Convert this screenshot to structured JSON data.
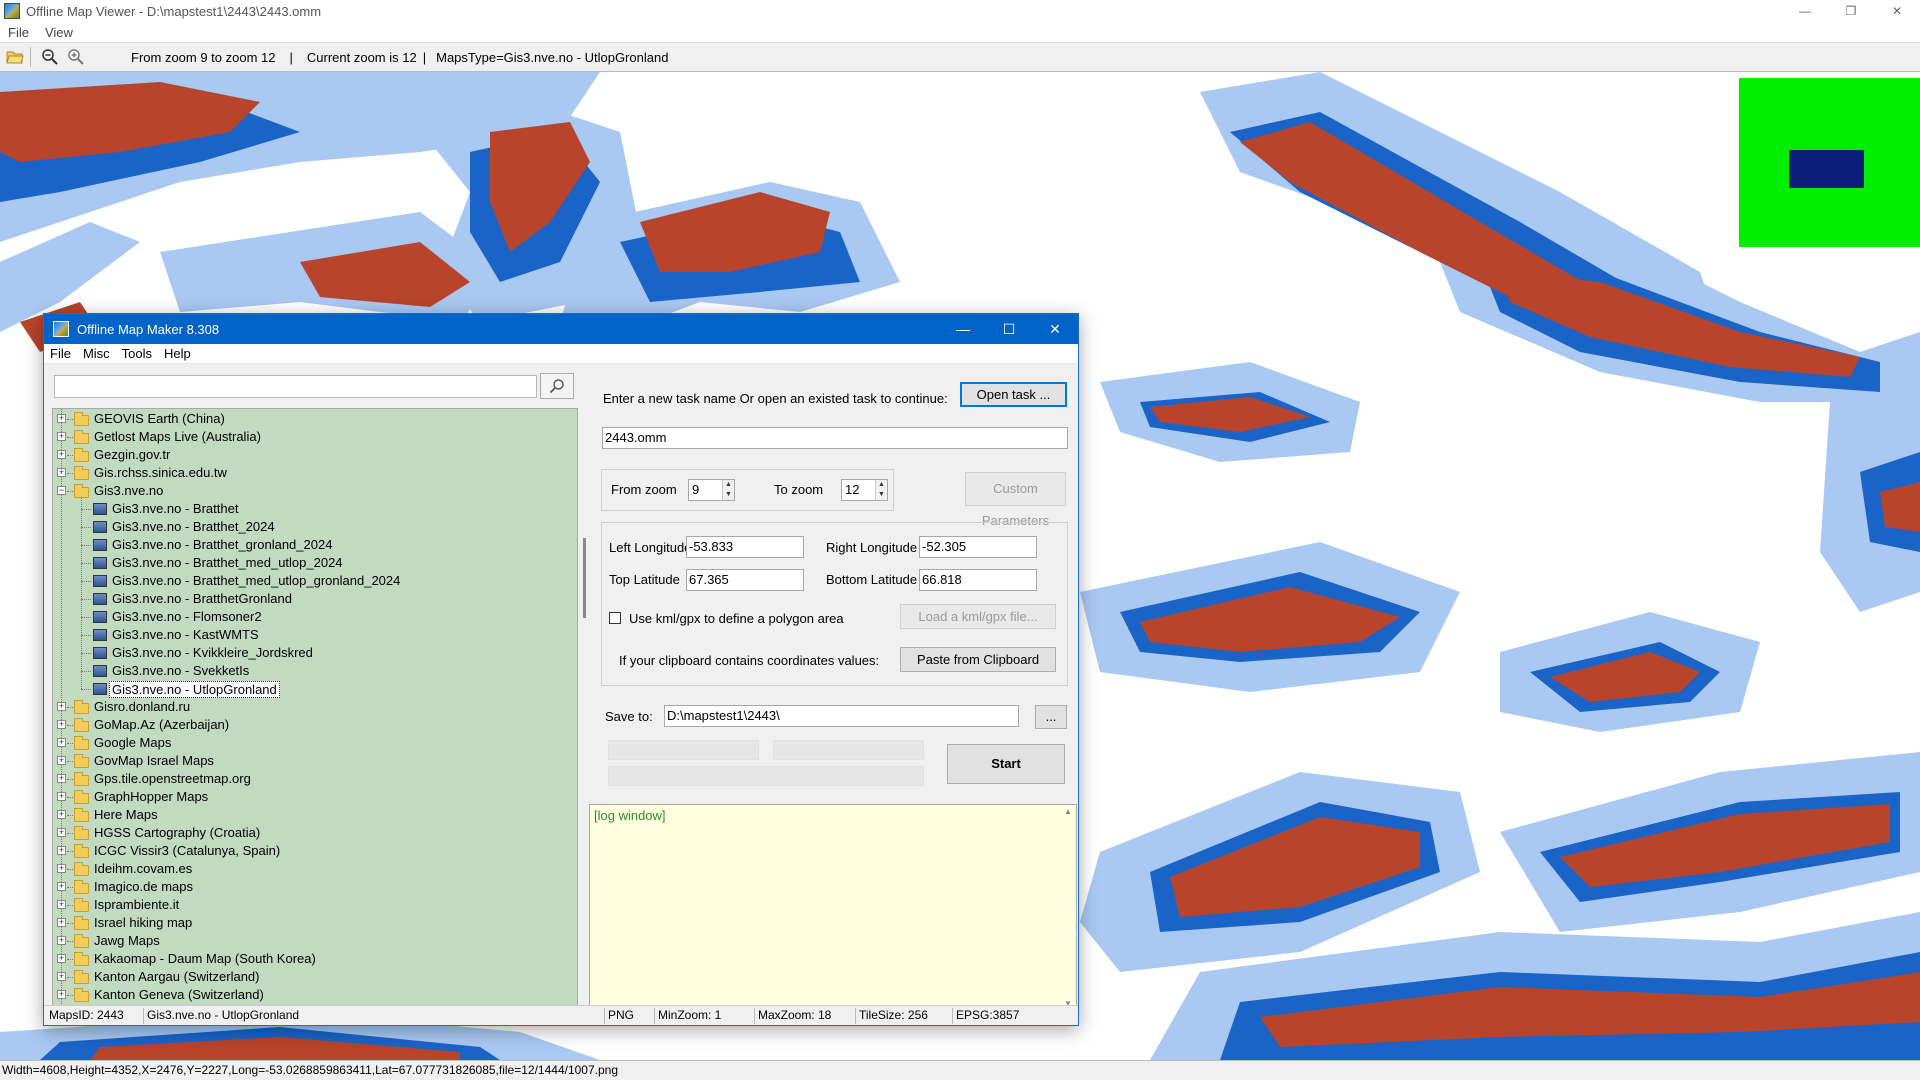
{
  "viewer": {
    "title": "Offline Map Viewer - D:\\mapstest1\\2443\\2443.omm",
    "menu": [
      "File",
      "View"
    ],
    "toolbar": {
      "zoom_range": "From zoom 9 to zoom 12",
      "current_zoom": "Current zoom is 12",
      "maps_type": "MapsType=Gis3.nve.no - UtlopGronland",
      "separator": "|"
    },
    "status": "Width=4608,Height=4352,X=2476,Y=2227,Long=-53.0268859863411,Lat=67.077731826085,file=12/1444/1007.png",
    "colors": {
      "map_red": "#b8442c",
      "map_blue": "#1a64c8",
      "map_lightblue": "#a9c8f2",
      "minimap_green": "#00ee00",
      "minimap_view": "#0a1e7a"
    }
  },
  "dialog": {
    "title": "Offline Map Maker 8.308",
    "menu": [
      "File",
      "Misc",
      "Tools",
      "Help"
    ],
    "search": {
      "value": ""
    },
    "tree": [
      {
        "label": "GEOVIS Earth (China)",
        "type": "folder",
        "expanded": false
      },
      {
        "label": "Getlost Maps Live (Australia)",
        "type": "folder",
        "expanded": false
      },
      {
        "label": "Gezgin.gov.tr",
        "type": "folder",
        "expanded": false
      },
      {
        "label": "Gis.rchss.sinica.edu.tw",
        "type": "folder",
        "expanded": false
      },
      {
        "label": "Gis3.nve.no",
        "type": "folder",
        "expanded": true
      },
      {
        "label": "Gis3.nve.no - Bratthet",
        "type": "map"
      },
      {
        "label": "Gis3.nve.no - Bratthet_2024",
        "type": "map"
      },
      {
        "label": "Gis3.nve.no - Bratthet_gronland_2024",
        "type": "map"
      },
      {
        "label": "Gis3.nve.no - Bratthet_med_utlop_2024",
        "type": "map"
      },
      {
        "label": "Gis3.nve.no - Bratthet_med_utlop_gronland_2024",
        "type": "map"
      },
      {
        "label": "Gis3.nve.no - BratthetGronland",
        "type": "map"
      },
      {
        "label": "Gis3.nve.no - Flomsoner2",
        "type": "map"
      },
      {
        "label": "Gis3.nve.no - KastWMTS",
        "type": "map"
      },
      {
        "label": "Gis3.nve.no - Kvikkleire_Jordskred",
        "type": "map"
      },
      {
        "label": "Gis3.nve.no - SvekketIs",
        "type": "map"
      },
      {
        "label": "Gis3.nve.no - UtlopGronland",
        "type": "map",
        "selected": true
      },
      {
        "label": "Gisro.donland.ru",
        "type": "folder",
        "expanded": false
      },
      {
        "label": "GoMap.Az (Azerbaijan)",
        "type": "folder",
        "expanded": false
      },
      {
        "label": "Google Maps",
        "type": "folder",
        "expanded": false
      },
      {
        "label": "GovMap Israel Maps",
        "type": "folder",
        "expanded": false
      },
      {
        "label": "Gps.tile.openstreetmap.org",
        "type": "folder",
        "expanded": false
      },
      {
        "label": "GraphHopper Maps",
        "type": "folder",
        "expanded": false
      },
      {
        "label": "Here Maps",
        "type": "folder",
        "expanded": false
      },
      {
        "label": "HGSS Cartography (Croatia)",
        "type": "folder",
        "expanded": false
      },
      {
        "label": "ICGC Vissir3 (Catalunya, Spain)",
        "type": "folder",
        "expanded": false
      },
      {
        "label": "Ideihm.covam.es",
        "type": "folder",
        "expanded": false
      },
      {
        "label": "Imagico.de maps",
        "type": "folder",
        "expanded": false
      },
      {
        "label": "Isprambiente.it",
        "type": "folder",
        "expanded": false
      },
      {
        "label": "Israel hiking map",
        "type": "folder",
        "expanded": false
      },
      {
        "label": "Jawg Maps",
        "type": "folder",
        "expanded": false
      },
      {
        "label": "Kakaomap - Daum Map (South Korea)",
        "type": "folder",
        "expanded": false
      },
      {
        "label": "Kanton Aargau (Switzerland)",
        "type": "folder",
        "expanded": false
      },
      {
        "label": "Kanton Geneva (Switzerland)",
        "type": "folder",
        "expanded": false
      }
    ],
    "task": {
      "prompt": "Enter a new task name Or open an existed task to continue:",
      "open_button": "Open task ...",
      "name": "2443.omm"
    },
    "zoom": {
      "from_label": "From zoom",
      "from_value": "9",
      "to_label": "To zoom",
      "to_value": "12",
      "custom_button": "Custom Parameters"
    },
    "bounds": {
      "left_label": "Left Longitude",
      "left_value": "-53.833",
      "right_label": "Right Longitude",
      "right_value": "-52.305",
      "top_label": "Top Latitude",
      "top_value": "67.365",
      "bottom_label": "Bottom Latitude",
      "bottom_value": "66.818"
    },
    "kml": {
      "checkbox_label": "Use kml/gpx to define a polygon area",
      "checked": false,
      "load_button": "Load a kml/gpx file..."
    },
    "clipboard": {
      "label": "If your clipboard contains coordinates values:",
      "button": "Paste from Clipboard"
    },
    "save": {
      "label": "Save to:",
      "path": "D:\\mapstest1\\2443\\",
      "browse_button": "..."
    },
    "start_button": "Start",
    "log_text": "[log window]",
    "status": {
      "maps_id": "MapsID: 2443",
      "maps_name": "Gis3.nve.no - UtlopGronland",
      "format": "PNG",
      "min_zoom": "MinZoom: 1",
      "max_zoom": "MaxZoom: 18",
      "tile_size": "TileSize: 256",
      "epsg": "EPSG:3857"
    }
  }
}
